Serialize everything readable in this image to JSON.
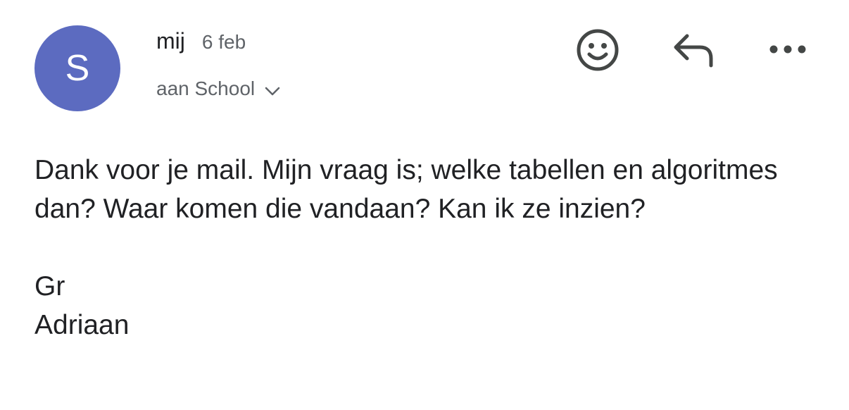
{
  "sender": {
    "avatar_letter": "S",
    "avatar_color": "#5c6bc0",
    "name": "mij",
    "date": "6 feb"
  },
  "recipient": {
    "label": "aan School"
  },
  "actions": {
    "emoji_icon": "smiley-icon",
    "reply_icon": "reply-arrow-icon",
    "more_icon": "more-horizontal-icon"
  },
  "body": {
    "paragraph": "Dank voor je mail. Mijn vraag is; welke tabellen en algoritmes dan? Waar komen die vandaan? Kan ik ze inzien?",
    "closing": "Gr",
    "signature": "Adriaan"
  }
}
